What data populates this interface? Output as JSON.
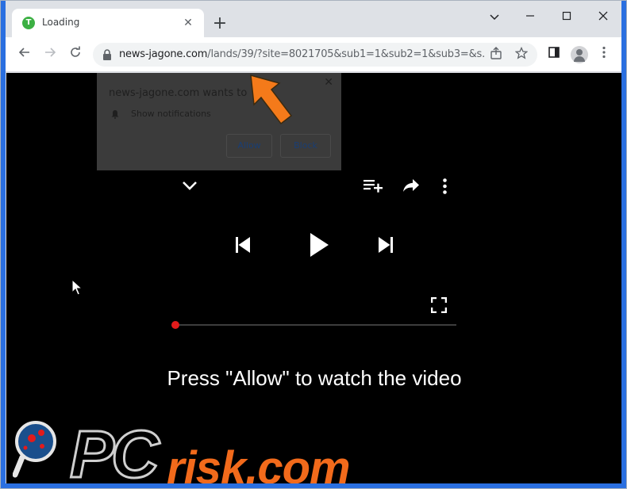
{
  "tab": {
    "title": "Loading",
    "favicon_letter": "T"
  },
  "toolbar": {
    "url_domain": "news-jagone.com",
    "url_path": "/lands/39/?site=8021705&sub1=1&sub2=1&sub3=&s..."
  },
  "notification": {
    "title": "news-jagone.com wants to",
    "permission": "Show notifications",
    "allow_label": "Allow",
    "block_label": "Block"
  },
  "page": {
    "cta": "Press \"Allow\" to watch the video",
    "progress": 0
  },
  "watermark": {
    "pc": "PC",
    "risk": "risk.com"
  },
  "colors": {
    "accent": "#f26a1b",
    "progress": "#e31b1b",
    "window_frame": "#2a6fe0"
  }
}
